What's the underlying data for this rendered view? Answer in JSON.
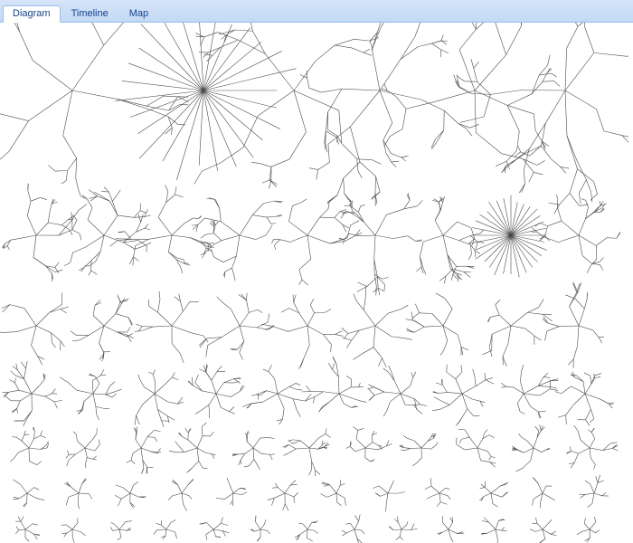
{
  "tabs": {
    "items": [
      {
        "label": "Diagram",
        "active": true
      },
      {
        "label": "Timeline",
        "active": false
      },
      {
        "label": "Map",
        "active": false
      }
    ]
  }
}
